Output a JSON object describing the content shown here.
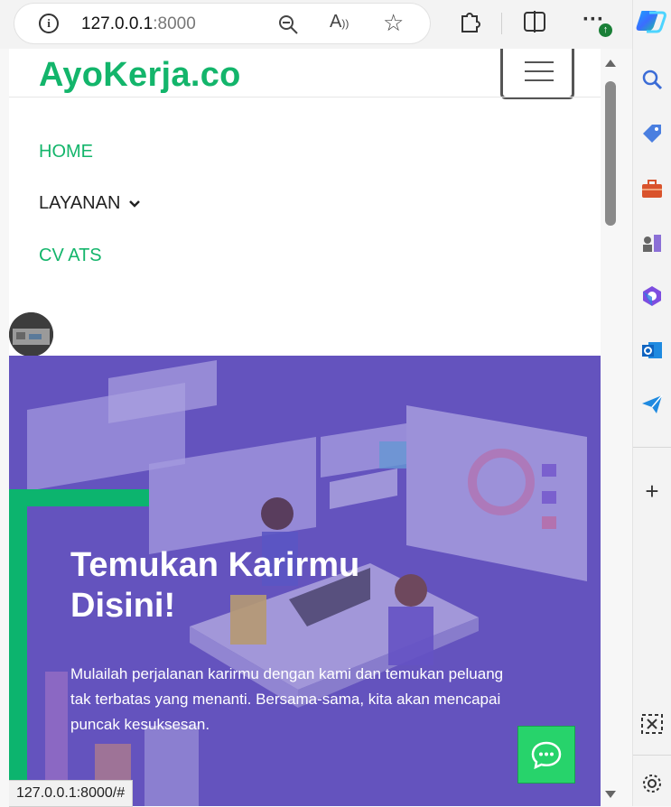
{
  "browser": {
    "url_host": "127.0.0.1",
    "url_port": ":8000",
    "status_url": "127.0.0.1:8000/#"
  },
  "site": {
    "brand": "AyoKerja.co",
    "nav": {
      "home": "HOME",
      "layanan": "LAYANAN",
      "cv_ats": "CV ATS"
    }
  },
  "hero": {
    "title": "Temukan Karirmu Disini!",
    "description": "Mulailah perjalanan karirmu dengan kami dan temukan peluang tak terbatas yang menanti. Bersama-sama, kita akan mencapai puncak kesuksesan."
  },
  "icons": {
    "info": "info-icon",
    "zoom": "zoom-out-icon",
    "read_aloud": "read-aloud-icon",
    "favorite": "star-icon",
    "extensions": "puzzle-icon",
    "split": "split-screen-icon",
    "more": "more-icon",
    "copilot": "copilot-icon",
    "chat": "chat-icon"
  },
  "colors": {
    "brand_green": "#13b56b",
    "hero_purple": "#6a5bbf",
    "chat_green": "#27d36b"
  }
}
